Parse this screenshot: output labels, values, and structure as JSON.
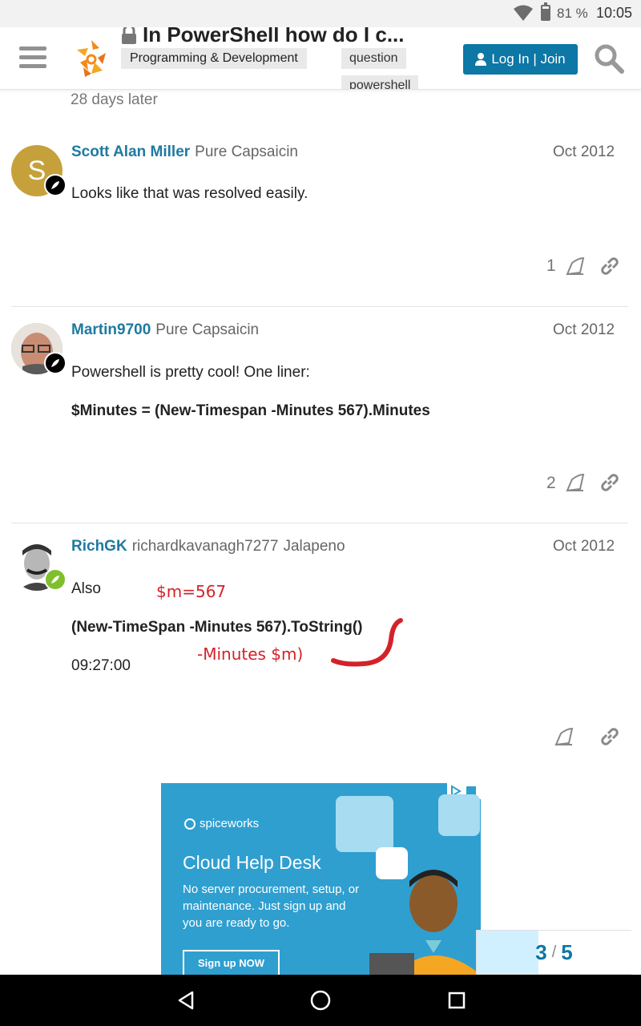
{
  "status_bar": {
    "battery_percent": 81,
    "battery_text": "81 %",
    "time": "10:05",
    "icons": [
      "wifi-icon",
      "battery-icon"
    ]
  },
  "header": {
    "title": "In PowerShell how do I c...",
    "category": "Programming & Development",
    "tags": [
      "question",
      "powershell"
    ],
    "login_label": "Log In | Join",
    "icons": [
      "menu-icon",
      "spiceworks-logo",
      "lock-icon",
      "user-icon",
      "search-icon"
    ]
  },
  "time_gap": "28 days later",
  "posts": [
    {
      "username": "Scott Alan Miller",
      "user_title": "Pure Capsaicin",
      "avatar_letter": "S",
      "avatar_color": "#c6a13b",
      "date": "Oct 2012",
      "lines": [
        "Looks like that was resolved easily."
      ],
      "likes": "1"
    },
    {
      "username": "Martin9700",
      "user_title": "Pure Capsaicin",
      "date": "Oct 2012",
      "lines": [
        "Powershell is pretty cool! One liner:",
        "$Minutes = (New-Timespan -Minutes 567).Minutes"
      ],
      "likes": "2"
    },
    {
      "username": "RichGK",
      "full_name": "richardkavanagh7277",
      "user_title": "Jalapeno",
      "date": "Oct 2012",
      "lines": [
        "Also",
        "(New-TimeSpan -Minutes 567).ToString()",
        "09:27:00"
      ],
      "annotations": [
        "$m=567",
        "-Minutes $m)"
      ]
    }
  ],
  "ad": {
    "brand": "spiceworks",
    "title": "Cloud Help Desk",
    "body": "No server procurement, setup, or maintenance. Just sign up and you are ready to go.",
    "cta": "Sign up NOW"
  },
  "progress": {
    "current": "3",
    "total": "5",
    "separator": "/",
    "fraction": 0.4
  },
  "colors": {
    "link": "#1e7aa0",
    "button": "#0d77a6",
    "annotation": "#d4222a",
    "progress_fill": "#d1f0ff",
    "ad_background": "#2f9fd0"
  },
  "navbar_icons": [
    "back-icon",
    "home-icon",
    "recents-icon"
  ]
}
